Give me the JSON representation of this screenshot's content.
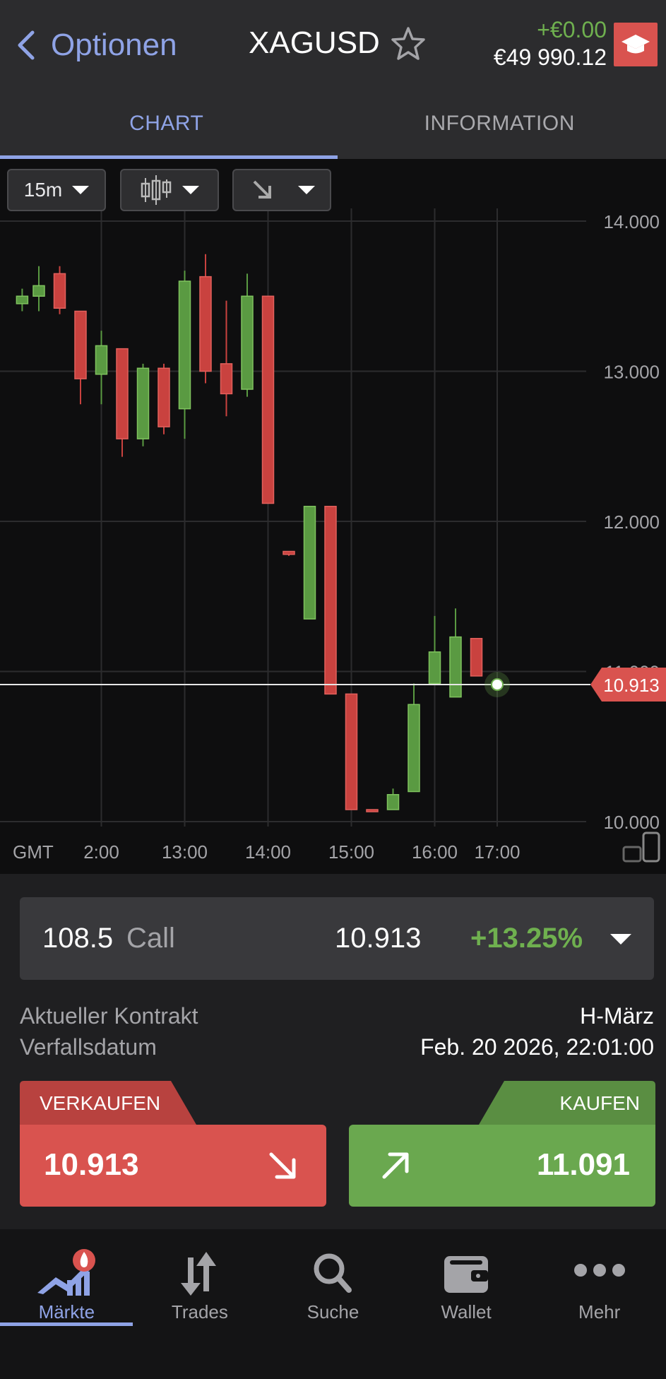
{
  "header": {
    "back_label": "Optionen",
    "symbol": "XAGUSD",
    "pnl_change": "+€0.00",
    "balance": "€49 990.12"
  },
  "tabs": [
    {
      "label": "CHART",
      "active": true
    },
    {
      "label": "INFORMATION",
      "active": false
    }
  ],
  "toolbar": {
    "timeframe": "15m"
  },
  "chart_data": {
    "type": "candlestick",
    "y_ticks": [
      "14.000",
      "13.000",
      "12.000",
      "11.000",
      "10.000"
    ],
    "ylim": [
      10.0,
      14.0
    ],
    "x_ticks": [
      {
        "label": "2:00",
        "x": 1
      },
      {
        "label": "13:00",
        "x": 5
      },
      {
        "label": "14:00",
        "x": 9
      },
      {
        "label": "15:00",
        "x": 13
      },
      {
        "label": "16:00",
        "x": 17
      },
      {
        "label": "17:00",
        "x": 20
      }
    ],
    "tz_label": "GMT",
    "last_price": "10.913",
    "last_price_value": 10.913,
    "candles": [
      {
        "i": -2.8,
        "o": 13.45,
        "c": 13.5,
        "h": 13.55,
        "l": 13.4
      },
      {
        "i": -2.0,
        "o": 13.5,
        "c": 13.57,
        "h": 13.7,
        "l": 13.4
      },
      {
        "i": -1.0,
        "o": 13.65,
        "c": 13.42,
        "h": 13.7,
        "l": 13.38
      },
      {
        "i": 0.0,
        "o": 13.4,
        "c": 12.95,
        "h": 13.4,
        "l": 12.78
      },
      {
        "i": 1.0,
        "o": 12.98,
        "c": 13.17,
        "h": 13.27,
        "l": 12.78
      },
      {
        "i": 2.0,
        "o": 13.15,
        "c": 12.55,
        "h": 13.15,
        "l": 12.43
      },
      {
        "i": 3.0,
        "o": 12.55,
        "c": 13.02,
        "h": 13.05,
        "l": 12.5
      },
      {
        "i": 4.0,
        "o": 13.02,
        "c": 12.63,
        "h": 13.05,
        "l": 12.58
      },
      {
        "i": 5.0,
        "o": 12.75,
        "c": 13.6,
        "h": 13.67,
        "l": 12.55
      },
      {
        "i": 6.0,
        "o": 13.63,
        "c": 13.0,
        "h": 13.78,
        "l": 12.92
      },
      {
        "i": 7.0,
        "o": 13.05,
        "c": 12.85,
        "h": 13.47,
        "l": 12.7
      },
      {
        "i": 8.0,
        "o": 12.88,
        "c": 13.5,
        "h": 13.65,
        "l": 12.83
      },
      {
        "i": 9.0,
        "o": 13.5,
        "c": 12.12,
        "h": 13.5,
        "l": 12.12
      },
      {
        "i": 10.0,
        "o": 11.8,
        "c": 11.78,
        "h": 11.8,
        "l": 11.77
      },
      {
        "i": 11.0,
        "o": 11.35,
        "c": 12.1,
        "h": 12.1,
        "l": 11.35
      },
      {
        "i": 12.0,
        "o": 12.1,
        "c": 10.85,
        "h": 12.1,
        "l": 10.85
      },
      {
        "i": 13.0,
        "o": 10.85,
        "c": 10.08,
        "h": 10.85,
        "l": 10.08
      },
      {
        "i": 14.0,
        "o": 10.08,
        "c": 10.07,
        "h": 10.08,
        "l": 10.07
      },
      {
        "i": 15.0,
        "o": 10.08,
        "c": 10.18,
        "h": 10.22,
        "l": 10.08
      },
      {
        "i": 16.0,
        "o": 10.2,
        "c": 10.78,
        "h": 10.92,
        "l": 10.2
      },
      {
        "i": 17.0,
        "o": 10.92,
        "c": 11.13,
        "h": 11.37,
        "l": 10.92
      },
      {
        "i": 18.0,
        "o": 10.83,
        "c": 11.23,
        "h": 11.42,
        "l": 10.83
      },
      {
        "i": 19.0,
        "o": 11.22,
        "c": 10.97,
        "h": 11.22,
        "l": 10.97
      }
    ],
    "colors": {
      "up": "#5a9a42",
      "down": "#c9423f",
      "grid": "#2c2c2e",
      "price_tag": "#d9534f"
    }
  },
  "contract": {
    "strike": "108.5",
    "type": "Call",
    "price": "10.913",
    "change": "+13.25%"
  },
  "info": {
    "contract_label": "Aktueller Kontrakt",
    "contract_value": "H-März",
    "expiry_label": "Verfallsdatum",
    "expiry_value": "Feb. 20 2026, 22:01:00"
  },
  "trade": {
    "sell_label": "VERKAUFEN",
    "sell_price": "10.913",
    "buy_label": "KAUFEN",
    "buy_price": "11.091"
  },
  "nav": [
    {
      "label": "Märkte",
      "icon": "markets-icon",
      "active": true
    },
    {
      "label": "Trades",
      "icon": "trades-icon",
      "active": false
    },
    {
      "label": "Suche",
      "icon": "search-icon",
      "active": false
    },
    {
      "label": "Wallet",
      "icon": "wallet-icon",
      "active": false
    },
    {
      "label": "Mehr",
      "icon": "more-icon",
      "active": false
    }
  ],
  "colors": {
    "accent": "#8fa3e6",
    "positive": "#6fb04f",
    "negative": "#d9534f"
  }
}
